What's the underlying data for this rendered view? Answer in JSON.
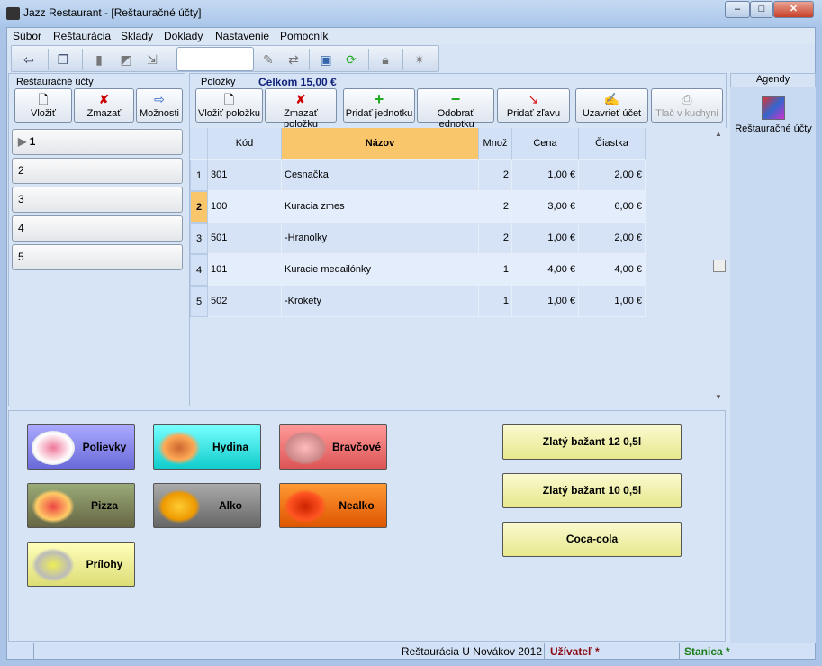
{
  "window": {
    "title": "Jazz Restaurant - [Reštauračné účty]"
  },
  "menu": [
    {
      "label": "Súbor",
      "key": "S",
      "rest": "úbor"
    },
    {
      "label": "Reštaurácia",
      "key": "R",
      "rest": "eštaurácia"
    },
    {
      "label": "Sklady",
      "pre": "S",
      "key": "k",
      "rest": "lady"
    },
    {
      "label": "Doklady",
      "key": "D",
      "rest": "oklady"
    },
    {
      "label": "Nastavenie",
      "key": "N",
      "rest": "astavenie"
    },
    {
      "label": "Pomocník",
      "key": "P",
      "rest": "omocník"
    }
  ],
  "left": {
    "title": "Reštauračné účty",
    "buttons": [
      "Vložiť",
      "Zmazať",
      "Možnosti"
    ],
    "accounts": [
      "1",
      "2",
      "3",
      "4",
      "5"
    ]
  },
  "items": {
    "title": "Položky",
    "total": "Celkom 15,00 €",
    "buttons": [
      "Vložiť položku",
      "Zmazať položku",
      "Pridať jednotku",
      "Odobrať jednotku",
      "Pridať zľavu",
      "Uzavrieť účet",
      "Tlač v kuchyni"
    ],
    "columns": [
      "Kód",
      "Názov",
      "Množ",
      "Cena",
      "Čiastka"
    ],
    "rows": [
      {
        "n": "1",
        "kod": "301",
        "nazov": "Cesnačka",
        "mnoz": "2",
        "cena": "1,00 €",
        "ciastka": "2,00 €"
      },
      {
        "n": "2",
        "kod": "100",
        "nazov": "Kuracia zmes",
        "mnoz": "2",
        "cena": "3,00 €",
        "ciastka": "6,00 €"
      },
      {
        "n": "3",
        "kod": "501",
        "nazov": "-Hranolky",
        "mnoz": "2",
        "cena": "1,00 €",
        "ciastka": "2,00 €"
      },
      {
        "n": "4",
        "kod": "101",
        "nazov": "Kuracie medailónky",
        "mnoz": "1",
        "cena": "4,00 €",
        "ciastka": "4,00 €"
      },
      {
        "n": "5",
        "kod": "502",
        "nazov": "-Krokety",
        "mnoz": "1",
        "cena": "1,00 €",
        "ciastka": "1,00 €"
      }
    ]
  },
  "agendy": {
    "title": "Agendy",
    "item": "Reštauračné účty"
  },
  "categories": [
    "Polievky",
    "Hydina",
    "Bravčové",
    "Pizza",
    "Alko",
    "Nealko",
    "Prílohy"
  ],
  "drinks": [
    "Zlatý bažant 12 0,5l",
    "Zlatý bažant 10 0,5l",
    "Coca-cola"
  ],
  "status": {
    "company": "Reštaurácia U Novákov 2012",
    "user": "Užívateľ *",
    "station": "Stanica *"
  }
}
